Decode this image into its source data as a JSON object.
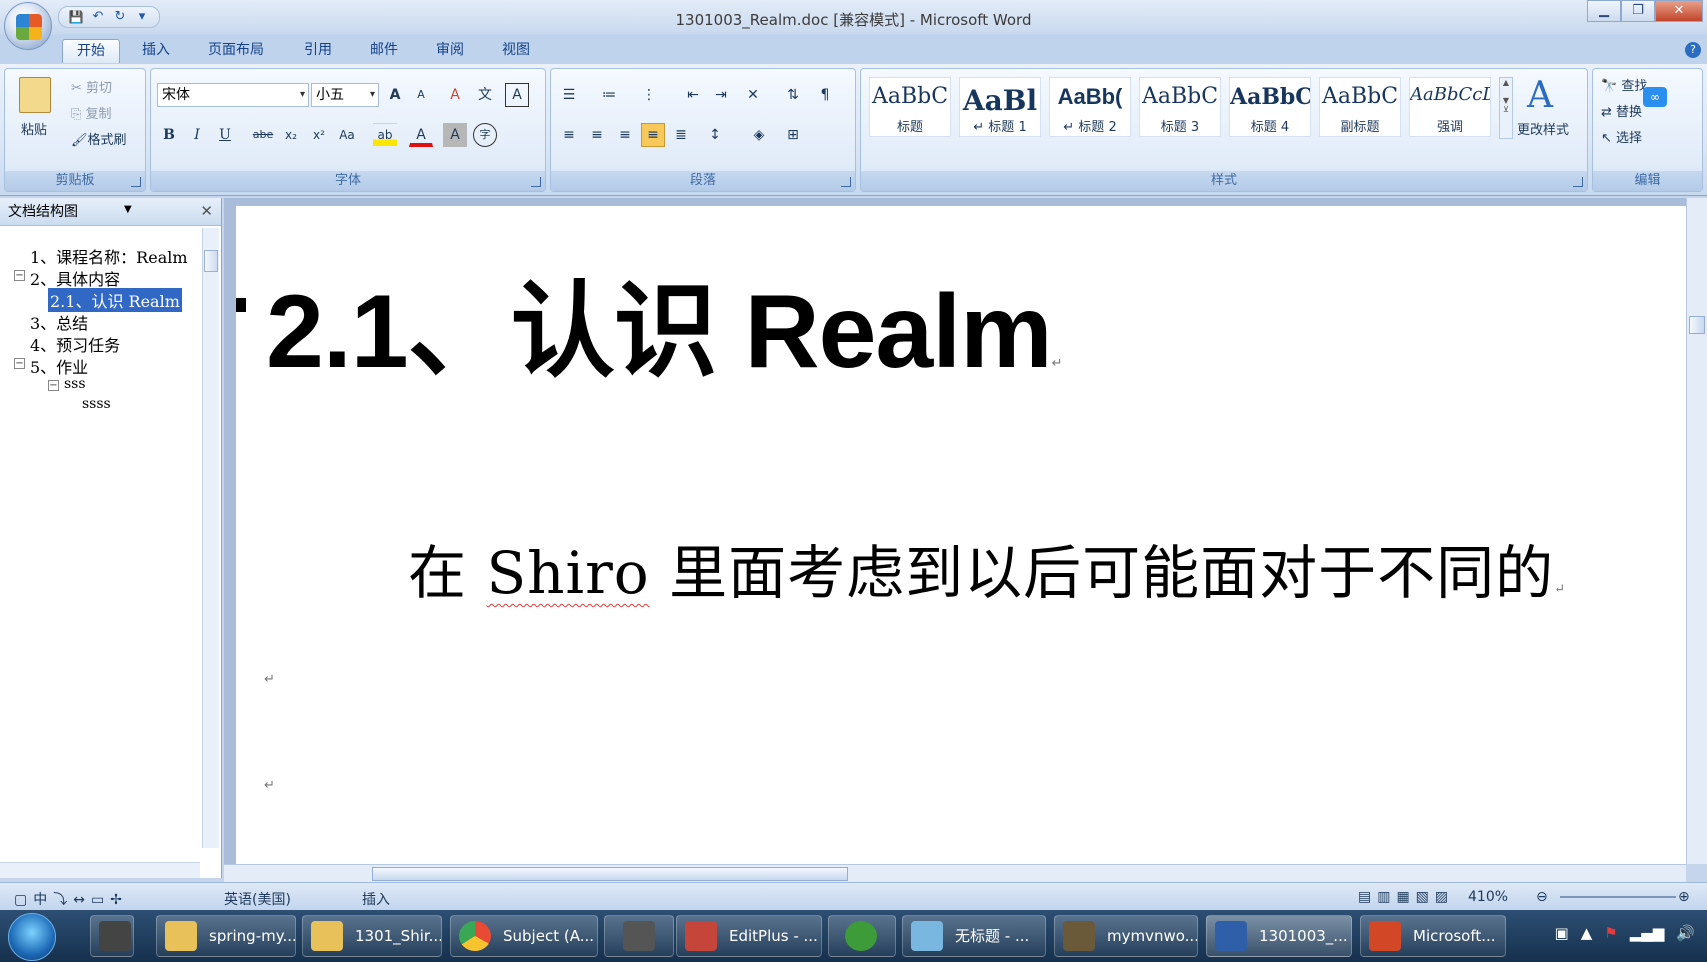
{
  "window": {
    "title": "1301003_Realm.doc [兼容模式] - Microsoft Word",
    "minimize": "▁",
    "maximize": "❐",
    "close": "✕"
  },
  "qat": {
    "save": "💾",
    "undo": "↶",
    "redo": "↻",
    "more": "▾"
  },
  "tabs": [
    "开始",
    "插入",
    "页面布局",
    "引用",
    "邮件",
    "审阅",
    "视图"
  ],
  "ribbon": {
    "clipboard": {
      "label": "剪贴板",
      "paste": "粘贴",
      "cut": "剪切",
      "copy": "复制",
      "format_painter": "格式刷"
    },
    "font": {
      "label": "字体",
      "font_name": "宋体",
      "font_size": "小五",
      "bold": "B",
      "italic": "I",
      "underline": "U",
      "strike": "abe",
      "sub": "x₂",
      "sup": "x²",
      "case": "Aa",
      "grow": "A",
      "shrink": "A",
      "clear": "A",
      "phonetic": "文",
      "border": "A",
      "highlight": "ab",
      "color": "A",
      "shade": "A",
      "enclose": "字"
    },
    "paragraph": {
      "label": "段落"
    },
    "styles": {
      "label": "样式",
      "items": [
        {
          "sample": "AaBbC",
          "name": "标题"
        },
        {
          "sample": "AaBl",
          "name": "↵ 标题 1"
        },
        {
          "sample": "AaBb(",
          "name": "↵ 标题 2"
        },
        {
          "sample": "AaBbC",
          "name": "标题 3"
        },
        {
          "sample": "AaBbC",
          "name": "标题 4"
        },
        {
          "sample": "AaBbC",
          "name": "副标题"
        },
        {
          "sample": "AaBbCcD",
          "name": "强调"
        }
      ],
      "change_styles": "更改样式"
    },
    "editing": {
      "label": "编辑",
      "find": "查找",
      "replace": "替换",
      "select": "选择"
    }
  },
  "nav": {
    "title": "文档结构图",
    "items": [
      {
        "text": "1、课程名称：Realm"
      },
      {
        "text": "2、具体内容"
      },
      {
        "text": "2.1、认识 Realm"
      },
      {
        "text": "3、总结"
      },
      {
        "text": "4、预习任务"
      },
      {
        "text": "5、作业"
      },
      {
        "text": "sss"
      },
      {
        "text": "ssss"
      }
    ]
  },
  "document": {
    "heading": "2.1、认识 Realm",
    "body_before": "在 ",
    "body_word": "Shiro",
    "body_after": " 里面考虑到以后可能面对于不同的",
    "para_mark": "↵"
  },
  "status": {
    "language": "英语(美国)",
    "mode": "插入",
    "zoom": "410%"
  },
  "taskbar": {
    "items": [
      {
        "label": "spring-my...",
        "color": "#e8c15a"
      },
      {
        "label": "1301_Shir...",
        "color": "#e8c15a"
      },
      {
        "label": "Subject (A...",
        "color": "#e94a35"
      },
      {
        "label": "",
        "color": "#555555"
      },
      {
        "label": "EditPlus - ...",
        "color": "#c6453a"
      },
      {
        "label": "",
        "color": "#3e9b3a"
      },
      {
        "label": "无标题 - ...",
        "color": "#7ab7e0"
      },
      {
        "label": "mymvnwo...",
        "color": "#6b5a3a"
      },
      {
        "label": "1301003_...",
        "color": "#2f5fa8"
      },
      {
        "label": "Microsoft...",
        "color": "#d24726"
      }
    ]
  },
  "colors": {
    "accent": "#3168c6",
    "ribbon": "#dbe7f6",
    "taskbar": "#16304d"
  }
}
